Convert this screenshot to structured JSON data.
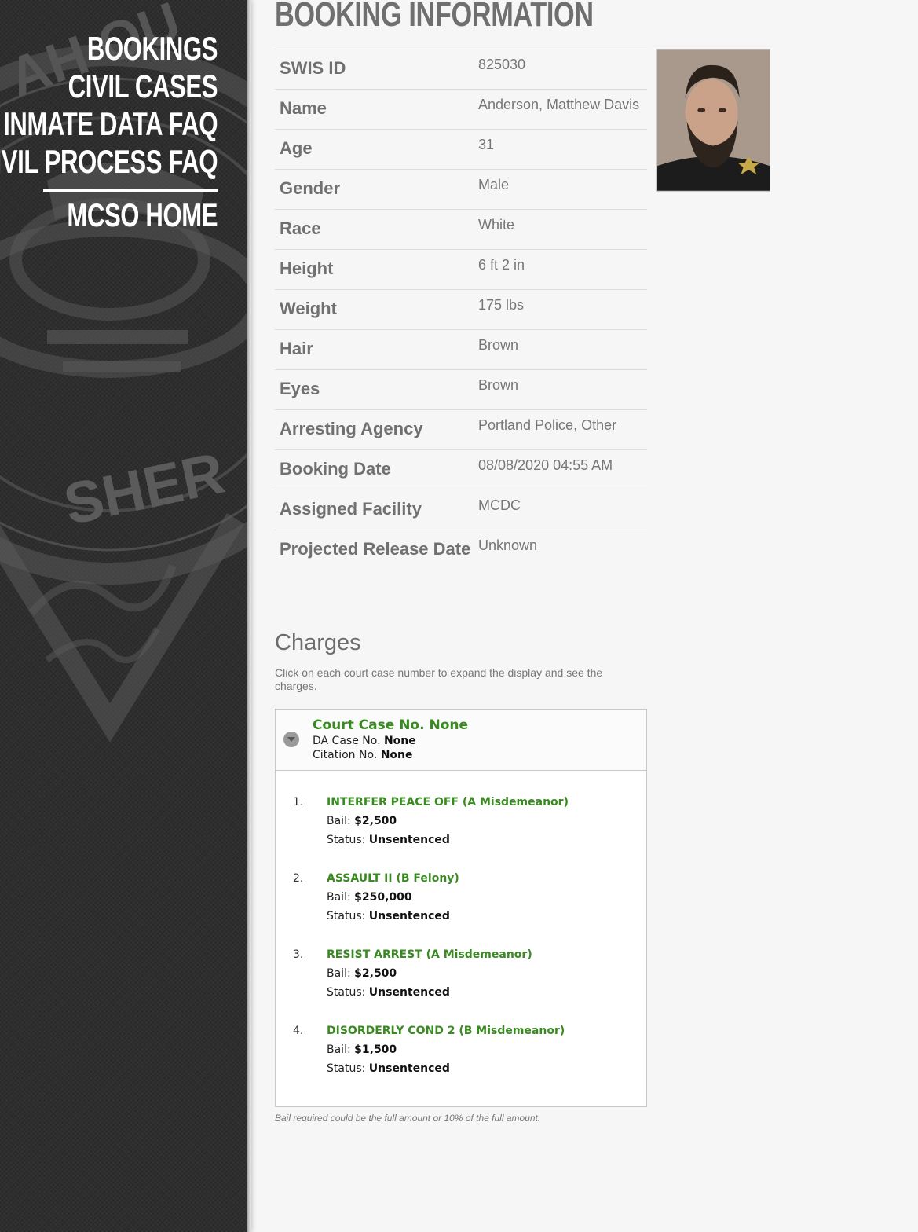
{
  "nav": {
    "items": [
      "BOOKINGS",
      "CIVIL CASES",
      "INMATE DATA FAQ",
      "CIVIL PROCESS FAQ"
    ],
    "home": "MCSO HOME"
  },
  "seal": {
    "text": "SHER"
  },
  "page_title": "BOOKING INFORMATION",
  "booking": [
    {
      "label": "SWIS ID",
      "value": "825030"
    },
    {
      "label": "Name",
      "value": "Anderson, Matthew Davis"
    },
    {
      "label": "Age",
      "value": "31"
    },
    {
      "label": "Gender",
      "value": "Male"
    },
    {
      "label": "Race",
      "value": "White"
    },
    {
      "label": "Height",
      "value": "6 ft 2 in"
    },
    {
      "label": "Weight",
      "value": "175 lbs"
    },
    {
      "label": "Hair",
      "value": "Brown"
    },
    {
      "label": "Eyes",
      "value": "Brown"
    },
    {
      "label": "Arresting Agency",
      "value": "Portland Police, Other"
    },
    {
      "label": "Booking Date",
      "value": "08/08/2020 04:55 AM"
    },
    {
      "label": "Assigned Facility",
      "value": "MCDC"
    },
    {
      "label": "Projected Release Date",
      "value": "Unknown"
    }
  ],
  "charges": {
    "title": "Charges",
    "hint": "Click on each court case number to expand the display and see the charges.",
    "case": {
      "court_case_label": "Court Case No.",
      "court_case_value": "None",
      "da_case_label": "DA Case No.",
      "da_case_value": "None",
      "citation_label": "Citation No.",
      "citation_value": "None"
    },
    "bail_label": "Bail:",
    "status_label": "Status:",
    "items": [
      {
        "num": "1.",
        "name": "INTERFER PEACE OFF (A Misdemeanor)",
        "bail": "$2,500",
        "status": "Unsentenced"
      },
      {
        "num": "2.",
        "name": "ASSAULT II (B Felony)",
        "bail": "$250,000",
        "status": "Unsentenced"
      },
      {
        "num": "3.",
        "name": "RESIST ARREST (A Misdemeanor)",
        "bail": "$2,500",
        "status": "Unsentenced"
      },
      {
        "num": "4.",
        "name": "DISORDERLY COND 2 (B Misdemeanor)",
        "bail": "$1,500",
        "status": "Unsentenced"
      }
    ],
    "bail_note": "Bail required could be the full amount or 10% of the full amount."
  },
  "colors": {
    "sidebar": "#2e2e2e",
    "link_green": "#3a8a22",
    "page_bg": "#f6f6f6"
  }
}
